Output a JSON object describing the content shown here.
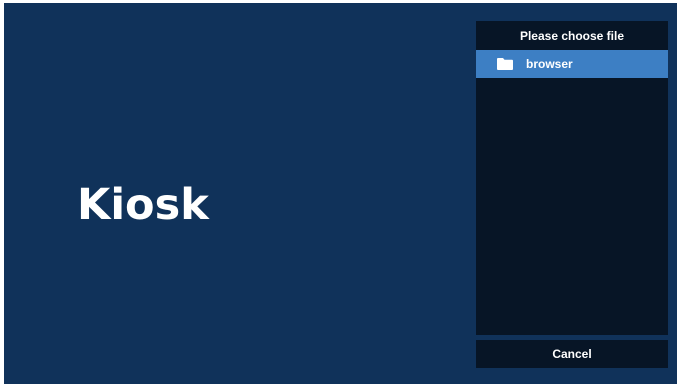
{
  "main": {
    "title": "Kiosk"
  },
  "file_dialog": {
    "header": "Please choose file",
    "items": [
      {
        "label": "browser",
        "icon": "folder-icon",
        "selected": true
      }
    ],
    "cancel_label": "Cancel"
  },
  "colors": {
    "screen_background": "#10325a",
    "panel_background": "#071526",
    "selection": "#3d7fc4",
    "text": "#ffffff"
  }
}
